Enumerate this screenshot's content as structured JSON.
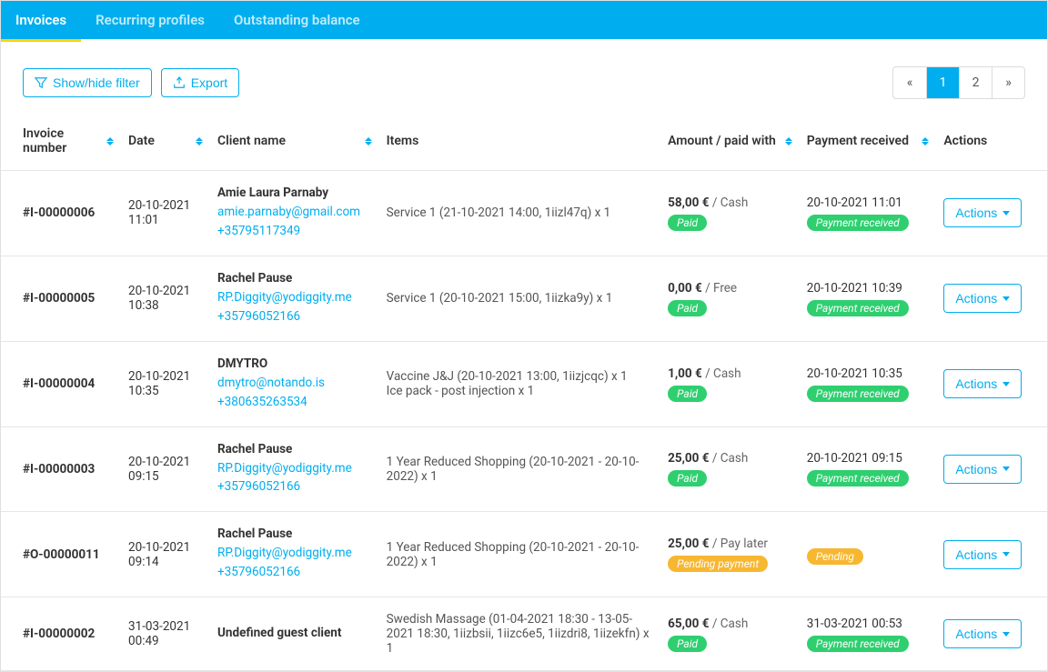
{
  "tabs": [
    {
      "label": "Invoices",
      "active": true
    },
    {
      "label": "Recurring profiles",
      "active": false
    },
    {
      "label": "Outstanding balance",
      "active": false
    }
  ],
  "toolbar": {
    "filter_label": "Show/hide filter",
    "export_label": "Export"
  },
  "pagination": {
    "first": "«",
    "pages": [
      "1",
      "2"
    ],
    "active": 0,
    "last": "»"
  },
  "columns": {
    "invoice_number": "Invoice number",
    "date": "Date",
    "client_name": "Client name",
    "items": "Items",
    "amount": "Amount / paid with",
    "payment": "Payment received",
    "actions": "Actions"
  },
  "actions_btn": "Actions",
  "rows": [
    {
      "invoice_number": "#I-00000006",
      "date": "20-10-2021 11:01",
      "client": {
        "name": "Amie Laura Parnaby",
        "email": "amie.parnaby@gmail.com",
        "phone": "+35795117349"
      },
      "items": "Service 1 (21-10-2021 14:00, 1iizl47q) x 1",
      "amount": "58,00 €",
      "paid_with": " / Cash",
      "status_badge": "Paid",
      "status_color": "green",
      "payment_date": "20-10-2021 11:01",
      "payment_badge": "Payment received",
      "payment_color": "green"
    },
    {
      "invoice_number": "#I-00000005",
      "date": "20-10-2021 10:38",
      "client": {
        "name": "Rachel Pause",
        "email": "RP.Diggity@yodiggity.me",
        "phone": "+35796052166"
      },
      "items": "Service 1 (20-10-2021 15:00, 1iizka9y) x 1",
      "amount": "0,00 €",
      "paid_with": " / Free",
      "status_badge": "Paid",
      "status_color": "green",
      "payment_date": "20-10-2021 10:39",
      "payment_badge": "Payment received",
      "payment_color": "green"
    },
    {
      "invoice_number": "#I-00000004",
      "date": "20-10-2021 10:35",
      "client": {
        "name": "DMYTRO",
        "email": "dmytro@notando.is",
        "phone": "+380635263534"
      },
      "items": "Vaccine J&J (20-10-2021 13:00, 1iizjcqc) x 1\nIce pack - post injection x 1",
      "amount": "1,00 €",
      "paid_with": " / Cash",
      "status_badge": "Paid",
      "status_color": "green",
      "payment_date": "20-10-2021 10:35",
      "payment_badge": "Payment received",
      "payment_color": "green"
    },
    {
      "invoice_number": "#I-00000003",
      "date": "20-10-2021 09:15",
      "client": {
        "name": "Rachel Pause",
        "email": "RP.Diggity@yodiggity.me",
        "phone": "+35796052166"
      },
      "items": "1 Year Reduced Shopping (20-10-2021 - 20-10-2022) x 1",
      "amount": "25,00 €",
      "paid_with": " / Cash",
      "status_badge": "Paid",
      "status_color": "green",
      "payment_date": "20-10-2021 09:15",
      "payment_badge": "Payment received",
      "payment_color": "green"
    },
    {
      "invoice_number": "#O-00000011",
      "date": "20-10-2021 09:14",
      "client": {
        "name": "Rachel Pause",
        "email": "RP.Diggity@yodiggity.me",
        "phone": "+35796052166"
      },
      "items": "1 Year Reduced Shopping (20-10-2021 - 20-10-2022) x 1",
      "amount": "25,00 €",
      "paid_with": " / Pay later",
      "status_badge": "Pending payment",
      "status_color": "orange",
      "payment_date": "",
      "payment_badge": "Pending",
      "payment_color": "orange"
    },
    {
      "invoice_number": "#I-00000002",
      "date": "31-03-2021 00:49",
      "client": {
        "name": "Undefined guest client",
        "email": "",
        "phone": ""
      },
      "items": "Swedish Massage (01-04-2021 18:30 - 13-05-2021 18:30, 1iizbsii, 1iizc6e5, 1iizdri8, 1iizekfn) x 1",
      "amount": "65,00 €",
      "paid_with": " / Cash",
      "status_badge": "Paid",
      "status_color": "green",
      "payment_date": "31-03-2021 00:53",
      "payment_badge": "Payment received",
      "payment_color": "green"
    }
  ]
}
